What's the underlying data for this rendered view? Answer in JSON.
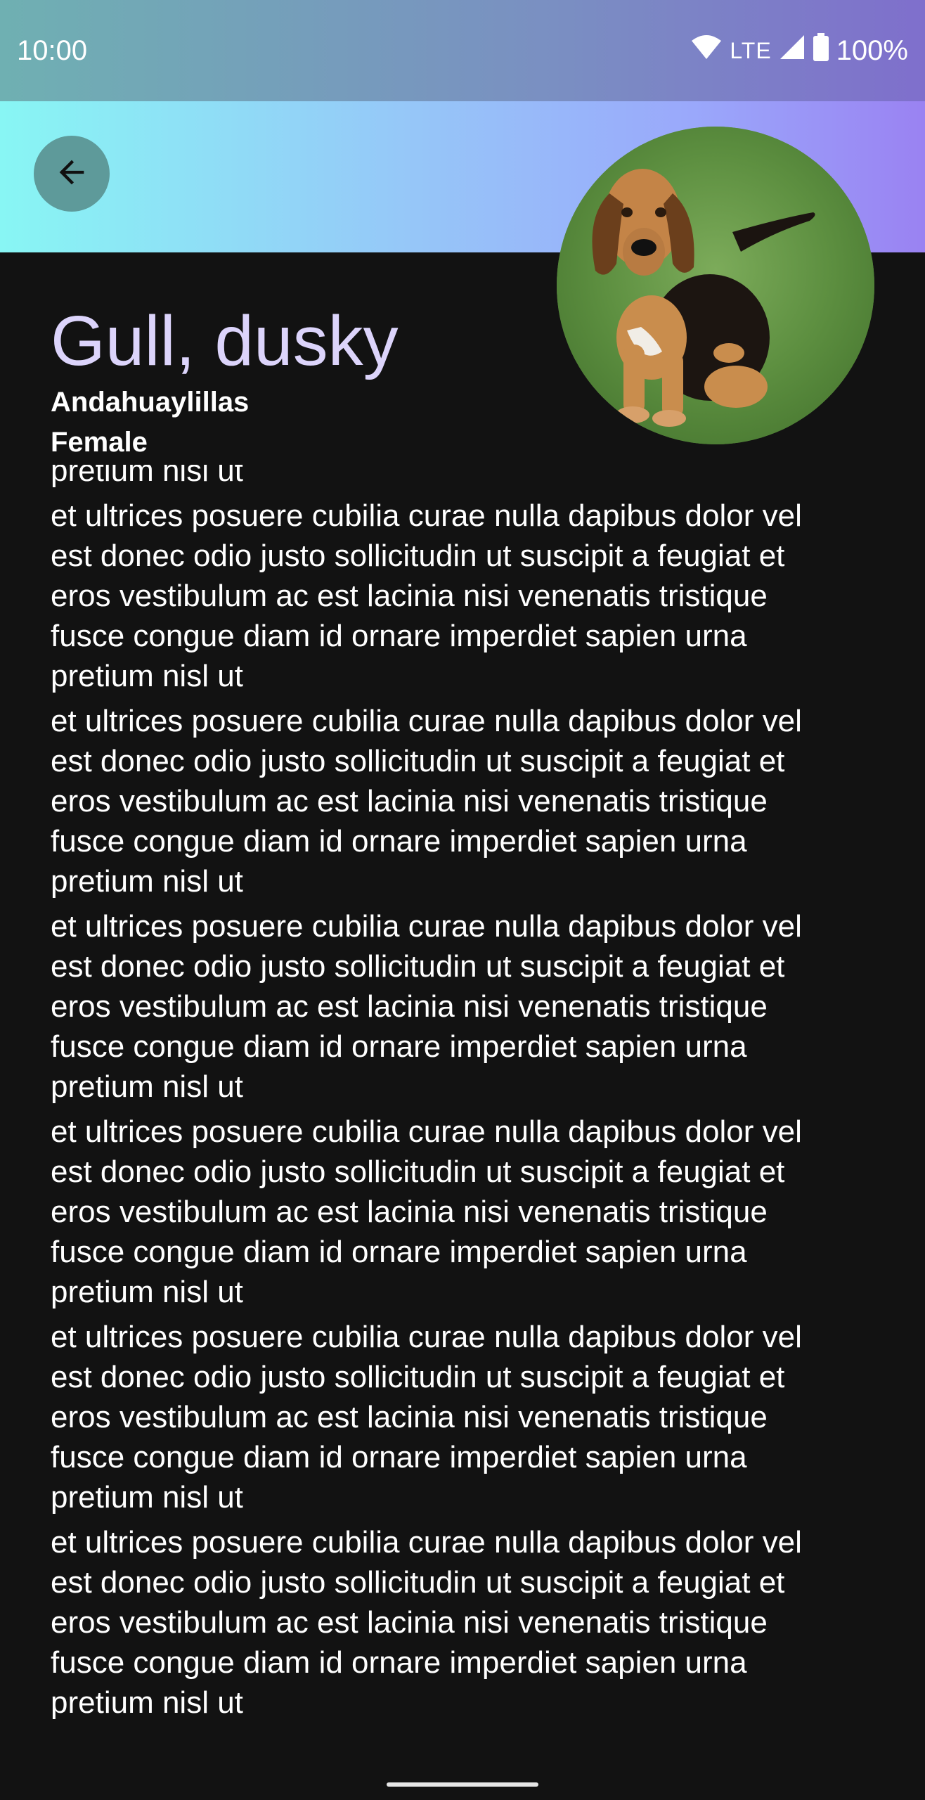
{
  "status_bar": {
    "time": "10:00",
    "network": "LTE",
    "battery": "100%",
    "icons": [
      "wifi-icon",
      "signal-icon",
      "battery-icon"
    ]
  },
  "header": {
    "back_icon": "arrow-back-icon"
  },
  "profile": {
    "name": "Gull, dusky",
    "location": "Andahuaylillas",
    "gender": "Female",
    "avatar": "dog-photo"
  },
  "body": {
    "partial_top_line": "pretium nisl ut",
    "paragraph_lines": [
      "et ultrices posuere cubilia curae nulla dapibus dolor vel",
      "est donec odio justo sollicitudin ut suscipit a feugiat et",
      "eros vestibulum ac est lacinia nisi venenatis tristique",
      "fusce congue diam id ornare imperdiet sapien urna",
      "pretium nisl ut"
    ],
    "paragraph_count": 6
  },
  "colors": {
    "background": "#121212",
    "title": "#dcd4fb",
    "back_button": "#5e9a9a"
  }
}
